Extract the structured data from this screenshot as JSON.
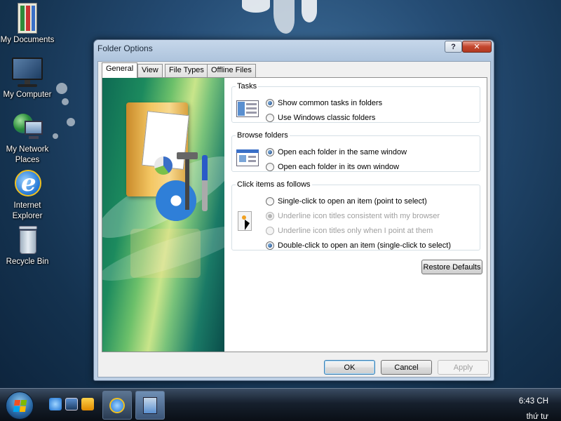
{
  "desktop": {
    "icons": [
      {
        "label": "My Documents",
        "icon": "my-documents-icon"
      },
      {
        "label": "My Computer",
        "icon": "computer-icon"
      },
      {
        "label": "My Network Places",
        "icon": "network-icon"
      },
      {
        "label": "Internet Explorer",
        "icon": "internet-explorer-icon"
      },
      {
        "label": "Recycle Bin",
        "icon": "recycle-bin-icon"
      }
    ]
  },
  "window": {
    "title": "Folder Options",
    "help_glyph": "?",
    "close_glyph": "✕",
    "tabs": [
      {
        "label": "General",
        "active": true
      },
      {
        "label": "View",
        "active": false
      },
      {
        "label": "File Types",
        "active": false
      },
      {
        "label": "Offline Files",
        "active": false
      }
    ],
    "groups": {
      "tasks": {
        "legend": "Tasks",
        "options": [
          {
            "label": "Show common tasks in folders",
            "checked": true,
            "enabled": true
          },
          {
            "label": "Use Windows classic folders",
            "checked": false,
            "enabled": true
          }
        ]
      },
      "browse": {
        "legend": "Browse folders",
        "options": [
          {
            "label": "Open each folder in the same window",
            "checked": true,
            "enabled": true
          },
          {
            "label": "Open each folder in its own window",
            "checked": false,
            "enabled": true
          }
        ]
      },
      "click": {
        "legend": "Click items as follows",
        "options": [
          {
            "label": "Single-click to open an item (point to select)",
            "checked": false,
            "enabled": true
          },
          {
            "label": "Underline icon titles consistent with my browser",
            "checked": true,
            "enabled": false
          },
          {
            "label": "Underline icon titles only when I point at them",
            "checked": false,
            "enabled": false
          },
          {
            "label": "Double-click to open an item (single-click to select)",
            "checked": true,
            "enabled": true
          }
        ]
      }
    },
    "buttons": {
      "restore_defaults": "Restore Defaults",
      "ok": "OK",
      "cancel": "Cancel",
      "apply": "Apply"
    }
  },
  "taskbar": {
    "time": "6:43 CH",
    "day": "thứ tư"
  },
  "colors": {
    "window_frame": "#aec4dd",
    "close_button": "#c3462d",
    "taskbar": "#16202d",
    "radio_selected": "#1b3f7a"
  }
}
